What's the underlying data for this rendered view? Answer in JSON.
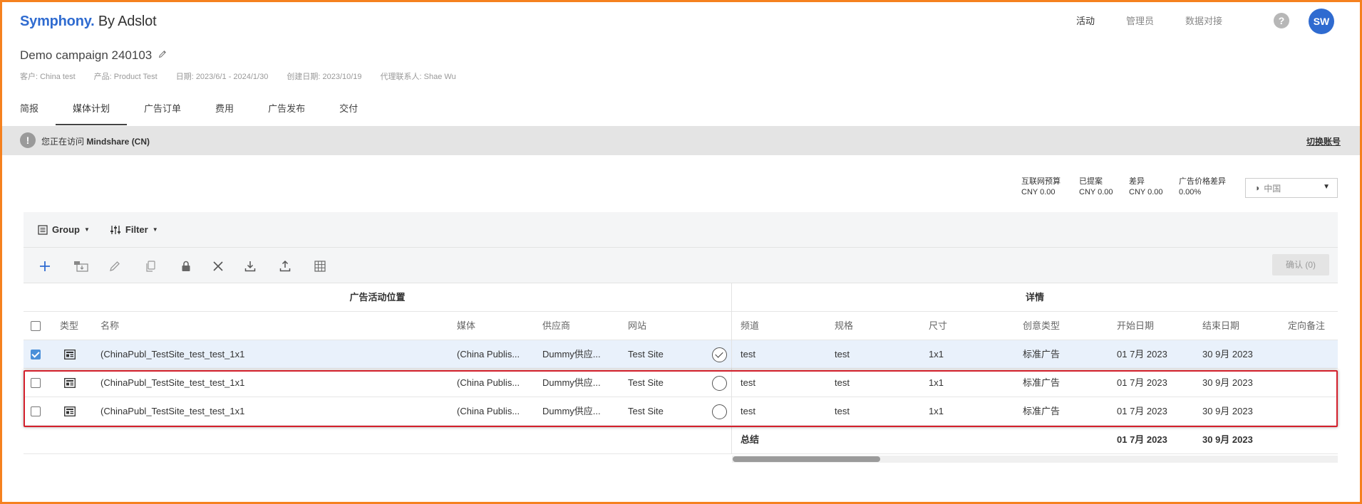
{
  "header": {
    "logo_brand": "Symphony.",
    "logo_suffix": " By Adslot",
    "nav": [
      "活动",
      "管理员",
      "数据对接"
    ],
    "help": "?",
    "avatar": "SW"
  },
  "campaign": {
    "title": "Demo campaign 240103",
    "meta": [
      "客户: China test",
      "产品: Product Test",
      "日期: 2023/6/1 - 2024/1/30",
      "创建日期: 2023/10/19",
      "代理联系人: Shae Wu"
    ]
  },
  "tabs": [
    "简报",
    "媒体计划",
    "广告订单",
    "费用",
    "广告发布",
    "交付"
  ],
  "notice": {
    "icon": "!",
    "prefix": "您正在访问 ",
    "account": "Mindshare (CN)",
    "switch": "切换账号"
  },
  "summary": [
    {
      "label": "互联网预算",
      "value": "CNY 0.00"
    },
    {
      "label": "已提案",
      "value": "CNY 0.00"
    },
    {
      "label": "差异",
      "value": "CNY 0.00"
    },
    {
      "label": "广告价格差异",
      "value": "0.00%"
    }
  ],
  "currency": {
    "value": "中国",
    "icon": "globe-icon"
  },
  "grid": {
    "group_label": "Group",
    "filter_label": "Filter",
    "confirm": "确认 (0)",
    "left_group": "广告活动位置",
    "right_group": "详情",
    "columns": {
      "type": "类型",
      "name": "名称",
      "media": "媒体",
      "supplier": "供应商",
      "site": "网站",
      "channel": "频道",
      "spec": "规格",
      "size": "尺寸",
      "creative": "创意类型",
      "start": "开始日期",
      "end": "结束日期",
      "targeting": "定向备注"
    },
    "rows": [
      {
        "checked": true,
        "name": "(ChinaPubl_TestSite_test_test_1x1",
        "media": "(China Publis...",
        "supplier": "Dummy供应...",
        "site": "Test Site",
        "status": "checked",
        "channel": "test",
        "spec": "test",
        "size": "1x1",
        "creative": "标准广告",
        "start": "01 7月 2023",
        "end": "30 9月 2023",
        "targeting": ""
      },
      {
        "checked": false,
        "name": "(ChinaPubl_TestSite_test_test_1x1",
        "media": "(China Publis...",
        "supplier": "Dummy供应...",
        "site": "Test Site",
        "status": "empty",
        "channel": "test",
        "spec": "test",
        "size": "1x1",
        "creative": "标准广告",
        "start": "01 7月 2023",
        "end": "30 9月 2023",
        "targeting": ""
      },
      {
        "checked": false,
        "name": "(ChinaPubl_TestSite_test_test_1x1",
        "media": "(China Publis...",
        "supplier": "Dummy供应...",
        "site": "Test Site",
        "status": "empty",
        "channel": "test",
        "spec": "test",
        "size": "1x1",
        "creative": "标准广告",
        "start": "01 7月 2023",
        "end": "30 9月 2023",
        "targeting": ""
      }
    ],
    "total": {
      "label": "总结",
      "start": "01 7月 2023",
      "end": "30 9月 2023"
    }
  },
  "colors": {
    "accent": "#f5811f",
    "brand": "#2f6bd0",
    "highlight": "#d4202c",
    "selected_row": "#e9f1fb"
  }
}
